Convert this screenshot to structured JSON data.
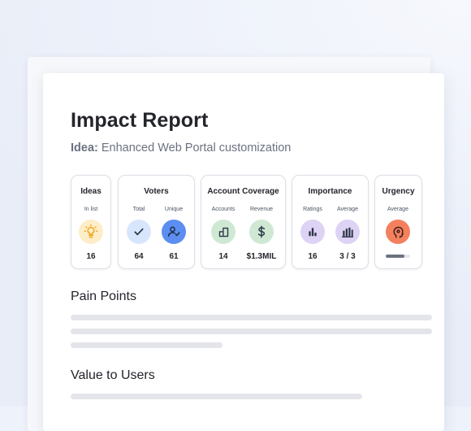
{
  "report": {
    "title": "Impact Report",
    "idea_prefix": "Idea:",
    "idea_name": "Enhanced Web Portal customization"
  },
  "metrics": {
    "ideas": {
      "title": "Ideas",
      "in_list_label": "In list",
      "in_list_value": "16"
    },
    "voters": {
      "title": "Voters",
      "total_label": "Total",
      "total_value": "64",
      "unique_label": "Unique",
      "unique_value": "61"
    },
    "account_coverage": {
      "title": "Account Coverage",
      "accounts_label": "Accounts",
      "accounts_value": "14",
      "revenue_label": "Revenue",
      "revenue_value": "$1.3MIL"
    },
    "importance": {
      "title": "Importance",
      "ratings_label": "Ratings",
      "ratings_value": "16",
      "average_label": "Average",
      "average_value": "3 / 3"
    },
    "urgency": {
      "title": "Urgency",
      "average_label": "Average",
      "average_level": 0.75
    }
  },
  "sections": {
    "pain_points": "Pain Points",
    "value_to_users": "Value to Users"
  },
  "colors": {
    "ideas_circle": "#fdeec8",
    "ideas_icon": "#f2a51d",
    "total_circle": "#d8e6fd",
    "unique_circle": "#5b8ef0",
    "accounts_circle": "#cfe8d3",
    "revenue_circle": "#cfe8d3",
    "ratings_circle": "#ddd3f4",
    "average_circle": "#ddd3f4",
    "urgency_circle": "#f4805e"
  },
  "icons": {
    "ideas": "lightbulb-icon",
    "total": "check-icon",
    "unique": "user-check-icon",
    "accounts": "building-icon",
    "revenue": "dollar-icon",
    "ratings": "bar-chart-icon",
    "average": "bar-chart-icon",
    "urgency": "urgency-head-icon"
  }
}
